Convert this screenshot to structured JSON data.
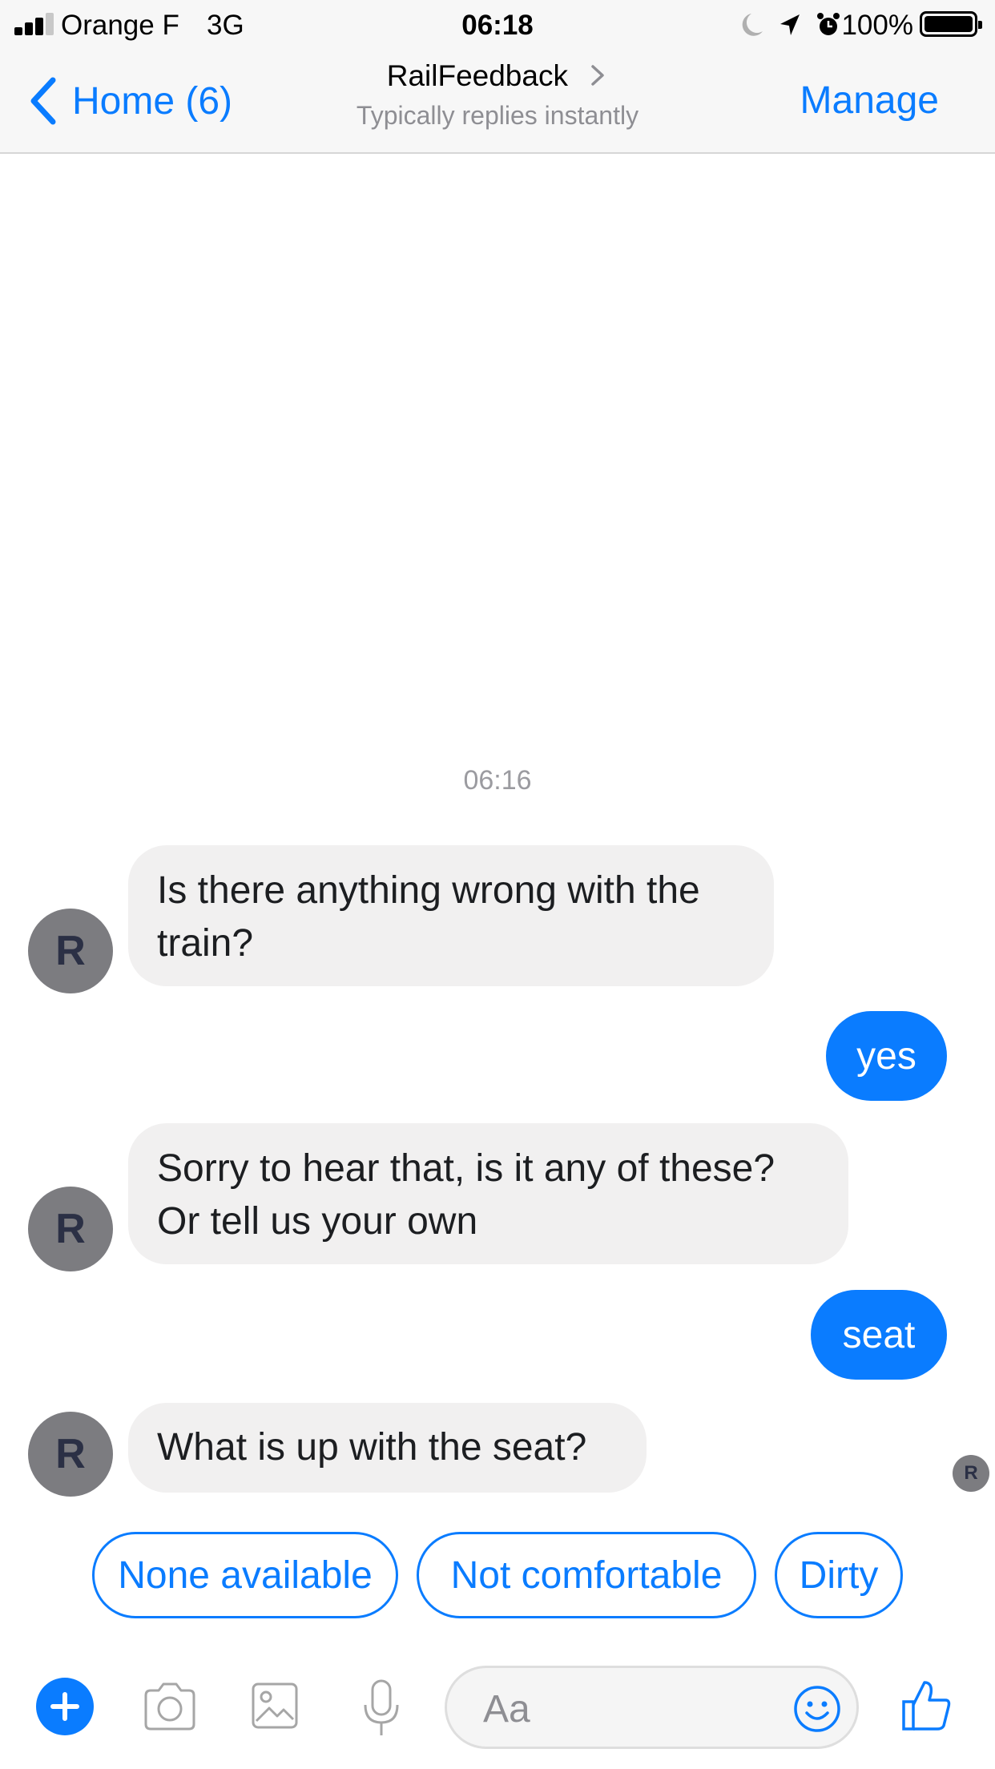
{
  "status_bar": {
    "carrier": "Orange F",
    "network": "3G",
    "time": "06:18",
    "battery": "100%",
    "icons": [
      "signal-bars-icon",
      "moon-icon",
      "location-arrow-icon",
      "alarm-clock-icon",
      "battery-icon"
    ]
  },
  "nav": {
    "back_label": "Home (6)",
    "title": "RailFeedback",
    "subtitle": "Typically replies instantly",
    "manage_label": "Manage"
  },
  "conversation": {
    "timestamp": "06:16",
    "avatar_letter": "R",
    "messages": [
      {
        "from": "bot",
        "lines": [
          "Is there anything wrong with the",
          "train?"
        ]
      },
      {
        "from": "user",
        "text": "yes"
      },
      {
        "from": "bot",
        "lines": [
          "Sorry to hear that, is it any of these?",
          "Or tell us your own"
        ]
      },
      {
        "from": "user",
        "text": "seat"
      },
      {
        "from": "bot",
        "lines": [
          "What is up with the seat?"
        ]
      }
    ],
    "read_receipt_letter": "R"
  },
  "quick_replies": [
    "None available",
    "Not comfortable",
    "Dirty"
  ],
  "composer": {
    "placeholder": "Aa",
    "icons": [
      "plus-icon",
      "camera-icon",
      "image-icon",
      "microphone-icon",
      "emoji-icon",
      "thumbs-up-icon"
    ]
  },
  "colors": {
    "accent": "#0a7cff",
    "incoming_bubble": "#f1f0f0",
    "avatar": "#7c7c80",
    "bar_background": "#f7f7f7"
  }
}
